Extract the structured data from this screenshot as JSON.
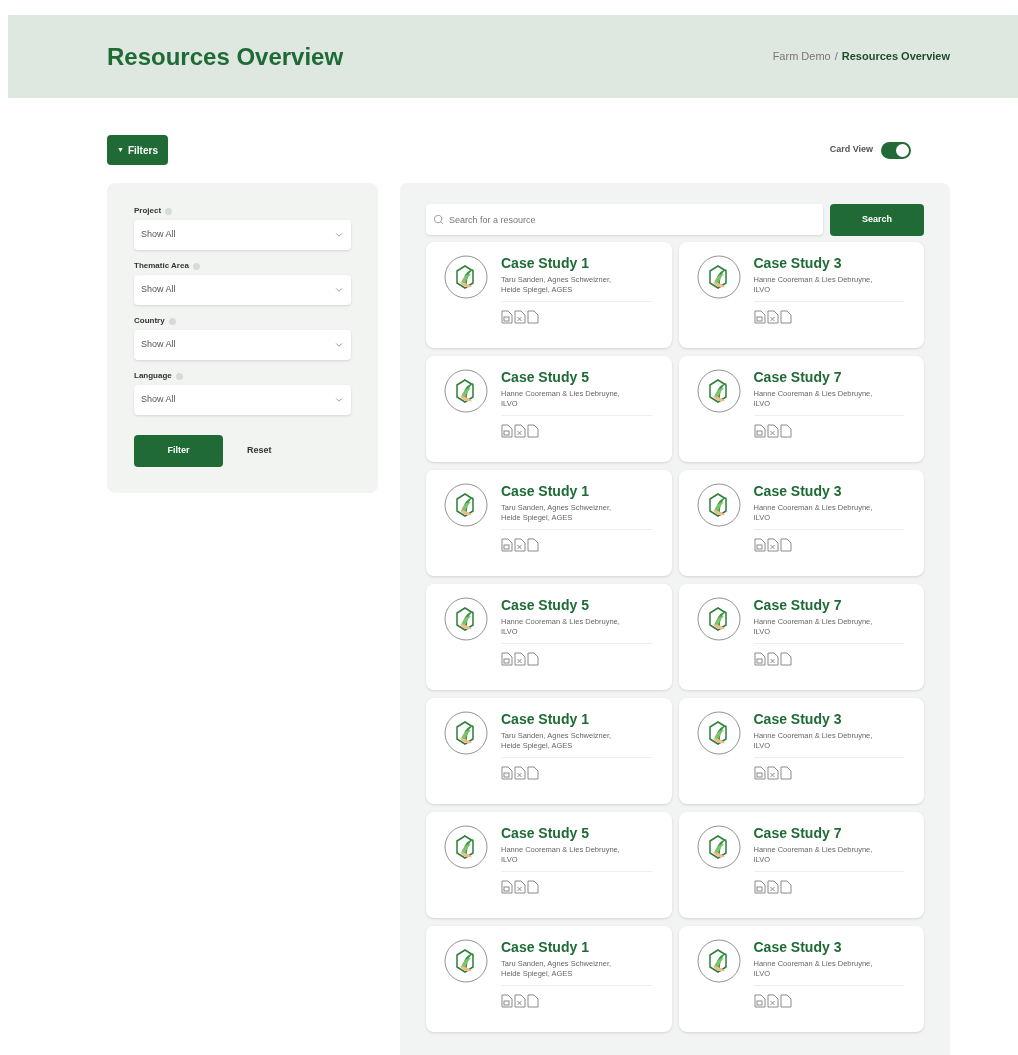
{
  "header": {
    "title": "Resources Overview",
    "breadcrumb_separator": "/",
    "breadcrumb": [
      {
        "label": "Farm Demo",
        "current": false
      },
      {
        "label": "Resources Overview",
        "current": true
      }
    ]
  },
  "filters_button": {
    "label": "Filters",
    "icon": "▼"
  },
  "card_view": {
    "label": "Card View",
    "on": true
  },
  "filters": [
    {
      "label": "Project",
      "value": "Show All"
    },
    {
      "label": "Thematic Area",
      "value": "Show All"
    },
    {
      "label": "Country",
      "value": "Show All"
    },
    {
      "label": "Language",
      "value": "Show All"
    }
  ],
  "filter_actions": {
    "apply": "Filter",
    "reset": "Reset"
  },
  "search": {
    "placeholder": "Search for a resource",
    "button": "Search"
  },
  "cards": [
    {
      "title": "Case Study 1",
      "authors": "Taru Sanden, Agnes Schweizner, Heide Spiegel, AGES"
    },
    {
      "title": "Case Study 3",
      "authors": "Hanne Cooreman & Lies Debruyne, ILVO"
    },
    {
      "title": "Case Study 5",
      "authors": "Hanne Cooreman & Lies Debruyne, ILVO"
    },
    {
      "title": "Case Study 7",
      "authors": "Hanne Cooreman & Lies Debruyne, ILVO"
    },
    {
      "title": "Case Study 1",
      "authors": "Taru Sanden, Agnes Schweizner, Heide Spiegel, AGES"
    },
    {
      "title": "Case Study 3",
      "authors": "Hanne Cooreman & Lies Debruyne, ILVO"
    },
    {
      "title": "Case Study 5",
      "authors": "Hanne Cooreman & Lies Debruyne, ILVO"
    },
    {
      "title": "Case Study 7",
      "authors": "Hanne Cooreman & Lies Debruyne, ILVO"
    },
    {
      "title": "Case Study 1",
      "authors": "Taru Sanden, Agnes Schweizner, Heide Spiegel, AGES"
    },
    {
      "title": "Case Study 3",
      "authors": "Hanne Cooreman & Lies Debruyne, ILVO"
    },
    {
      "title": "Case Study 5",
      "authors": "Hanne Cooreman & Lies Debruyne, ILVO"
    },
    {
      "title": "Case Study 7",
      "authors": "Hanne Cooreman & Lies Debruyne, ILVO"
    },
    {
      "title": "Case Study 1",
      "authors": "Taru Sanden, Agnes Schweizner, Heide Spiegel, AGES"
    },
    {
      "title": "Case Study 3",
      "authors": "Hanne Cooreman & Lies Debruyne, ILVO"
    }
  ]
}
